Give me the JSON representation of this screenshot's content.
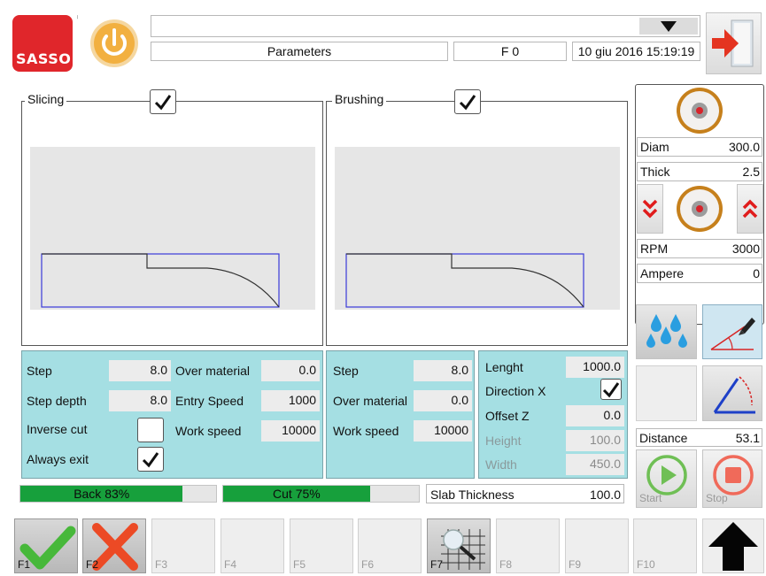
{
  "header": {
    "logo_text": "SASSO",
    "title": "Parameters",
    "program": "F 0",
    "datetime": "10 giu 2016 15:19:19",
    "dropdown_value": ""
  },
  "panels": {
    "slicing_label": "Slicing",
    "slicing_checked": true,
    "brushing_label": "Brushing",
    "brushing_checked": true
  },
  "tool": {
    "diam_label": "Diam",
    "diam_value": "300.0",
    "thick_label": "Thick",
    "thick_value": "2.5",
    "rpm_label": "RPM",
    "rpm_value": "3000",
    "ampere_label": "Ampere",
    "ampere_value": "0",
    "distance_label": "Distance",
    "distance_value": "53.1",
    "start_label": "Start",
    "stop_label": "Stop"
  },
  "slicing_params": {
    "step_label": "Step",
    "step_value": "8.0",
    "step_depth_label": "Step depth",
    "step_depth_value": "8.0",
    "inverse_cut_label": "Inverse cut",
    "inverse_cut_checked": false,
    "always_exit_label": "Always exit",
    "always_exit_checked": true,
    "over_material_label": "Over material",
    "over_material_value": "0.0",
    "entry_speed_label": "Entry Speed",
    "entry_speed_value": "1000",
    "work_speed_label": "Work speed",
    "work_speed_value": "10000"
  },
  "brushing_params": {
    "step_label": "Step",
    "step_value": "8.0",
    "over_material_label": "Over material",
    "over_material_value": "0.0",
    "work_speed_label": "Work speed",
    "work_speed_value": "10000"
  },
  "geometry_params": {
    "lenght_label": "Lenght",
    "lenght_value": "1000.0",
    "direction_label": "Direction X",
    "direction_checked": true,
    "offset_label": "Offset Z",
    "offset_value": "0.0",
    "height_label": "Height",
    "height_value": "100.0",
    "width_label": "Width",
    "width_value": "450.0"
  },
  "progress": {
    "back_label": "Back 83%",
    "back_fraction": 0.83,
    "cut_label": "Cut 75%",
    "cut_fraction": 0.75,
    "slab_label": "Slab Thickness",
    "slab_value": "100.0"
  },
  "fkeys": [
    "F1",
    "F2",
    "F3",
    "F4",
    "F5",
    "F6",
    "F7",
    "F8",
    "F9",
    "F10"
  ],
  "colors": {
    "accent_teal": "#a5dfe3",
    "progress_green": "#17a03c",
    "logo_red": "#e0262b",
    "profile_blue": "#3a3ad8"
  }
}
